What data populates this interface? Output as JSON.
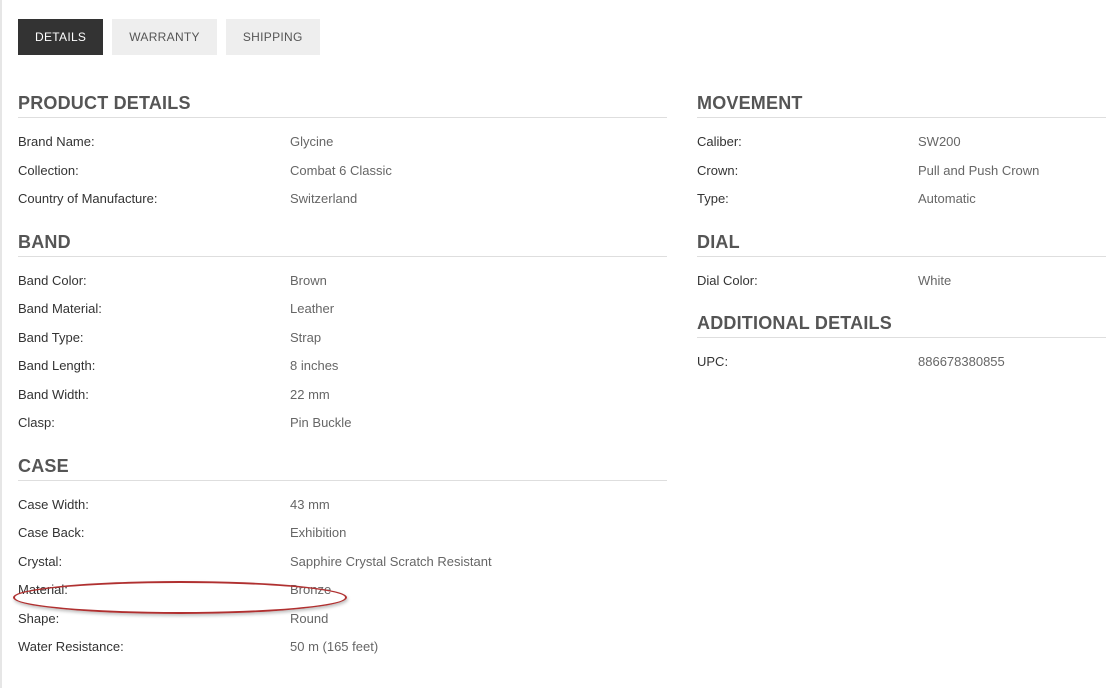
{
  "tabs": [
    {
      "label": "DETAILS",
      "active": true
    },
    {
      "label": "WARRANTY",
      "active": false
    },
    {
      "label": "SHIPPING",
      "active": false
    }
  ],
  "left_sections": [
    {
      "title": "PRODUCT DETAILS",
      "rows": [
        {
          "label": "Brand Name:",
          "value": "Glycine"
        },
        {
          "label": "Collection:",
          "value": "Combat 6 Classic"
        },
        {
          "label": "Country of Manufacture:",
          "value": "Switzerland"
        }
      ]
    },
    {
      "title": "BAND",
      "rows": [
        {
          "label": "Band Color:",
          "value": "Brown"
        },
        {
          "label": "Band Material:",
          "value": "Leather"
        },
        {
          "label": "Band Type:",
          "value": "Strap"
        },
        {
          "label": "Band Length:",
          "value": "8 inches"
        },
        {
          "label": "Band Width:",
          "value": "22 mm"
        },
        {
          "label": "Clasp:",
          "value": "Pin Buckle"
        }
      ]
    },
    {
      "title": "CASE",
      "rows": [
        {
          "label": "Case Width:",
          "value": "43 mm"
        },
        {
          "label": "Case Back:",
          "value": "Exhibition"
        },
        {
          "label": "Crystal:",
          "value": "Sapphire Crystal Scratch Resistant"
        },
        {
          "label": "Material:",
          "value": "Bronze"
        },
        {
          "label": "Shape:",
          "value": "Round"
        },
        {
          "label": "Water Resistance:",
          "value": "50 m (165 feet)"
        }
      ]
    }
  ],
  "right_sections": [
    {
      "title": "MOVEMENT",
      "rows": [
        {
          "label": "Caliber:",
          "value": "SW200"
        },
        {
          "label": "Crown:",
          "value": "Pull and Push Crown"
        },
        {
          "label": "Type:",
          "value": "Automatic"
        }
      ]
    },
    {
      "title": "DIAL",
      "rows": [
        {
          "label": "Dial Color:",
          "value": "White"
        }
      ]
    },
    {
      "title": "ADDITIONAL DETAILS",
      "rows": [
        {
          "label": "UPC:",
          "value": "886678380855"
        }
      ]
    }
  ],
  "colors": {
    "active_tab_bg": "#333333",
    "tab_bg": "#eeeeee",
    "highlight": "#b03030"
  }
}
